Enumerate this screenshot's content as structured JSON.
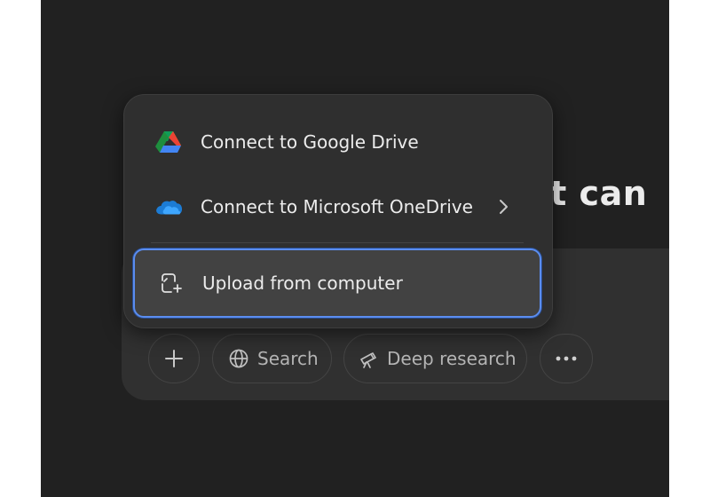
{
  "heading": {
    "partial_text": "at can"
  },
  "menu": {
    "items": [
      {
        "label": "Connect to Google Drive",
        "icon": "google-drive-icon"
      },
      {
        "label": "Connect to Microsoft OneDrive",
        "icon": "onedrive-icon",
        "has_submenu": true
      },
      {
        "label": "Upload from computer",
        "icon": "upload-file-icon",
        "selected": true
      }
    ]
  },
  "toolbar": {
    "add_icon": "plus-icon",
    "search_label": "Search",
    "search_icon": "globe-icon",
    "deep_research_label": "Deep research",
    "deep_research_icon": "telescope-icon",
    "more_icon": "ellipsis-icon"
  },
  "colors": {
    "background": "#212121",
    "composer": "#303030",
    "menu": "#2f2f2f",
    "selected_item": "#424242",
    "focus_ring": "#5b8def",
    "text": "#ececec",
    "muted_text": "#b4b4b4"
  }
}
